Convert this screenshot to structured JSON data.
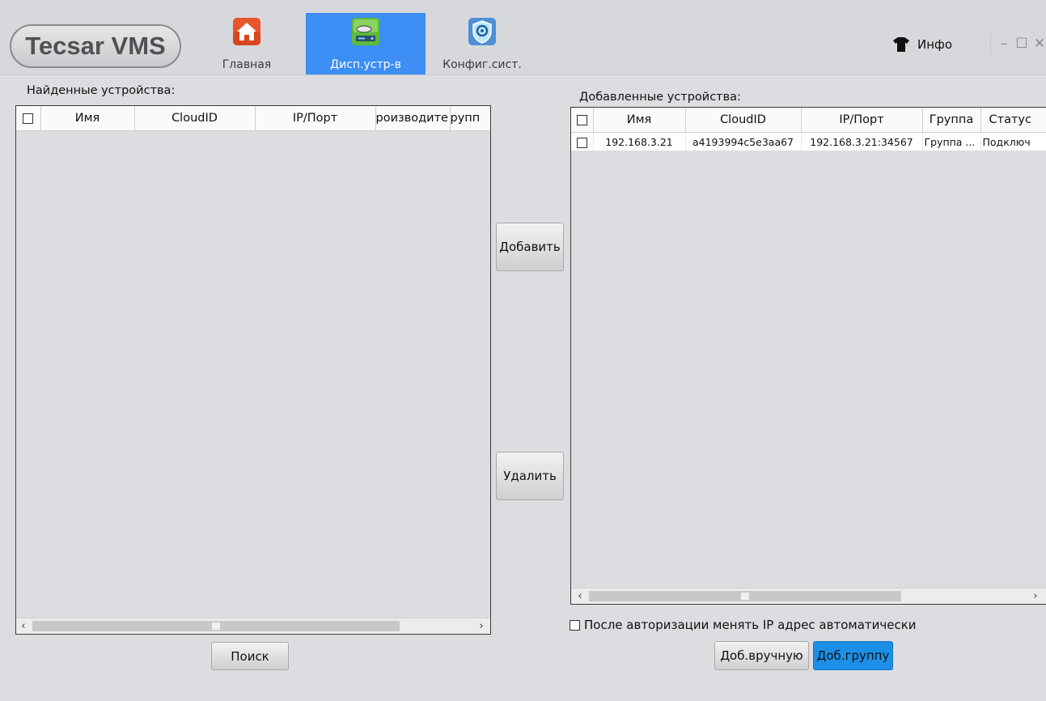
{
  "app": {
    "brand": "Tecsar VMS"
  },
  "nav": {
    "tabs": [
      {
        "label": "Главная",
        "icon": "home-icon",
        "active": false
      },
      {
        "label": "Дисп.устр-в",
        "icon": "device-manager-icon",
        "active": true
      },
      {
        "label": "Конфиг.сист.",
        "icon": "system-config-icon",
        "active": false
      }
    ],
    "active_color": "#3d8ef5"
  },
  "header": {
    "info_label": "Инфо",
    "minimize": "–",
    "maximize": "☐",
    "close": "✕"
  },
  "found_devices": {
    "title": "Найденные устройства:",
    "columns": [
      "Имя",
      "CloudID",
      "IP/Порт",
      "роизводите",
      "рупп"
    ],
    "rows": []
  },
  "added_devices": {
    "title": "Добавленные устройства:",
    "columns": [
      "Имя",
      "CloudID",
      "IP/Порт",
      "Группа",
      "Статус"
    ],
    "rows": [
      {
        "name": "192.168.3.21",
        "cloudid": "a4193994c5e3aa67",
        "ipport": "192.168.3.21:34567",
        "group": "Группа ...",
        "status": "Подключ"
      }
    ]
  },
  "actions": {
    "add": "Добавить",
    "remove": "Удалить",
    "search": "Поиск",
    "add_manual": "Доб.вручную",
    "add_group": "Доб.группу"
  },
  "options": {
    "auto_ip_label": "После авторизации менять IP адрес автоматически",
    "auto_ip_checked": false
  },
  "colors": {
    "background": "#dcdde1",
    "primary_button": "#1c8fe6"
  }
}
